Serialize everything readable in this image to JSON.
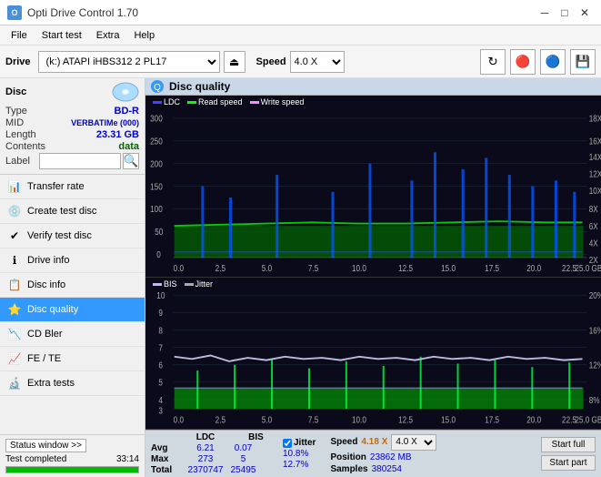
{
  "titlebar": {
    "title": "Opti Drive Control 1.70",
    "icon_text": "O",
    "minimize": "─",
    "maximize": "□",
    "close": "✕"
  },
  "menu": {
    "items": [
      "File",
      "Start test",
      "Extra",
      "Help"
    ]
  },
  "toolbar": {
    "drive_label": "Drive",
    "drive_value": "(k:) ATAPI iHBS312  2 PL17",
    "speed_label": "Speed",
    "speed_value": "4.0 X"
  },
  "disc": {
    "title": "Disc",
    "type_label": "Type",
    "type_value": "BD-R",
    "mid_label": "MID",
    "mid_value": "VERBATIMe (000)",
    "length_label": "Length",
    "length_value": "23.31 GB",
    "contents_label": "Contents",
    "contents_value": "data",
    "label_label": "Label",
    "label_placeholder": ""
  },
  "nav": {
    "items": [
      {
        "id": "transfer-rate",
        "label": "Transfer rate",
        "icon": "📊"
      },
      {
        "id": "create-test-disc",
        "label": "Create test disc",
        "icon": "💿"
      },
      {
        "id": "verify-test-disc",
        "label": "Verify test disc",
        "icon": "✔"
      },
      {
        "id": "drive-info",
        "label": "Drive info",
        "icon": "ℹ"
      },
      {
        "id": "disc-info",
        "label": "Disc info",
        "icon": "📋"
      },
      {
        "id": "disc-quality",
        "label": "Disc quality",
        "icon": "⭐",
        "active": true
      },
      {
        "id": "cd-bler",
        "label": "CD Bler",
        "icon": "📉"
      },
      {
        "id": "fe-te",
        "label": "FE / TE",
        "icon": "📈"
      },
      {
        "id": "extra-tests",
        "label": "Extra tests",
        "icon": "🔬"
      }
    ]
  },
  "statusbar": {
    "btn_label": "Status window >>",
    "status_text": "Test completed",
    "progress": 100,
    "time": "33:14"
  },
  "content": {
    "title": "Disc quality",
    "legend_top": {
      "ldc": "LDC",
      "read_speed": "Read speed",
      "write_speed": "Write speed"
    },
    "legend_bottom": {
      "bis": "BIS",
      "jitter": "Jitter"
    },
    "stats": {
      "ldc_label": "LDC",
      "bis_label": "BIS",
      "jitter_label": "Jitter",
      "speed_label": "Speed",
      "speed_value": "4.18 X",
      "speed_select": "4.0 X",
      "avg_label": "Avg",
      "avg_ldc": "6.21",
      "avg_bis": "0.07",
      "avg_jitter": "10.8%",
      "max_label": "Max",
      "max_ldc": "273",
      "max_bis": "5",
      "max_jitter": "12.7%",
      "position_label": "Position",
      "position_value": "23862 MB",
      "total_label": "Total",
      "total_ldc": "2370747",
      "total_bis": "25495",
      "samples_label": "Samples",
      "samples_value": "380254",
      "start_full": "Start full",
      "start_part": "Start part"
    }
  }
}
